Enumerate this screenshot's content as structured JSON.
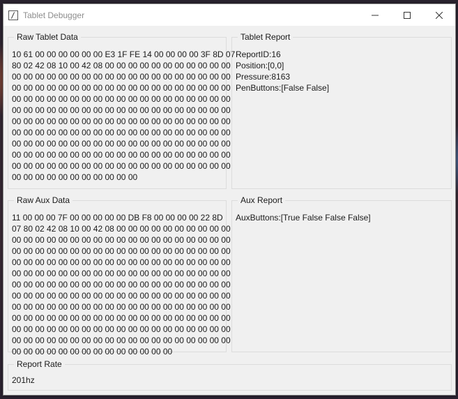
{
  "window": {
    "title": "Tablet Debugger",
    "controls": {
      "minimize": "minimize-icon",
      "maximize": "maximize-icon",
      "close": "close-icon"
    }
  },
  "raw_tablet": {
    "title": "Raw Tablet Data",
    "lines": [
      "10 61 00 00 00 00 00 00 E3 1F FE 14 00 00 00 00 3F 8D 07",
      "80 02 42 08 10 00 42 08 00 00 00 00 00 00 00 00 00 00 00",
      "00 00 00 00 00 00 00 00 00 00 00 00 00 00 00 00 00 00 00",
      "00 00 00 00 00 00 00 00 00 00 00 00 00 00 00 00 00 00 00",
      "00 00 00 00 00 00 00 00 00 00 00 00 00 00 00 00 00 00 00",
      "00 00 00 00 00 00 00 00 00 00 00 00 00 00 00 00 00 00 00",
      "00 00 00 00 00 00 00 00 00 00 00 00 00 00 00 00 00 00 00",
      "00 00 00 00 00 00 00 00 00 00 00 00 00 00 00 00 00 00 00",
      "00 00 00 00 00 00 00 00 00 00 00 00 00 00 00 00 00 00 00",
      "00 00 00 00 00 00 00 00 00 00 00 00 00 00 00 00 00 00 00",
      "00 00 00 00 00 00 00 00 00 00 00 00 00 00 00 00 00 00 00",
      "00 00 00 00 00 00 00 00 00 00 00"
    ]
  },
  "tablet_report": {
    "title": "Tablet Report",
    "report_id": "ReportID:16",
    "position": "Position:[0,0]",
    "pressure": "Pressure:8163",
    "pen_buttons": "PenButtons:[False False]"
  },
  "raw_aux": {
    "title": "Raw Aux Data",
    "lines": [
      "11 00 00 00 7F 00 00 00 00 00 DB F8 00 00 00 00 22 8D",
      "07 80 02 42 08 10 00 42 08 00 00 00 00 00 00 00 00 00 00",
      "00 00 00 00 00 00 00 00 00 00 00 00 00 00 00 00 00 00 00",
      "00 00 00 00 00 00 00 00 00 00 00 00 00 00 00 00 00 00 00",
      "00 00 00 00 00 00 00 00 00 00 00 00 00 00 00 00 00 00 00",
      "00 00 00 00 00 00 00 00 00 00 00 00 00 00 00 00 00 00 00",
      "00 00 00 00 00 00 00 00 00 00 00 00 00 00 00 00 00 00 00",
      "00 00 00 00 00 00 00 00 00 00 00 00 00 00 00 00 00 00 00",
      "00 00 00 00 00 00 00 00 00 00 00 00 00 00 00 00 00 00 00",
      "00 00 00 00 00 00 00 00 00 00 00 00 00 00 00 00 00 00 00",
      "00 00 00 00 00 00 00 00 00 00 00 00 00 00 00 00 00 00 00",
      "00 00 00 00 00 00 00 00 00 00 00 00 00 00 00 00 00 00 00",
      "00 00 00 00 00 00 00 00 00 00 00 00 00 00"
    ]
  },
  "aux_report": {
    "title": "Aux Report",
    "aux_buttons": "AuxButtons:[True False False False]"
  },
  "report_rate": {
    "title": "Report Rate",
    "value": "201hz"
  }
}
